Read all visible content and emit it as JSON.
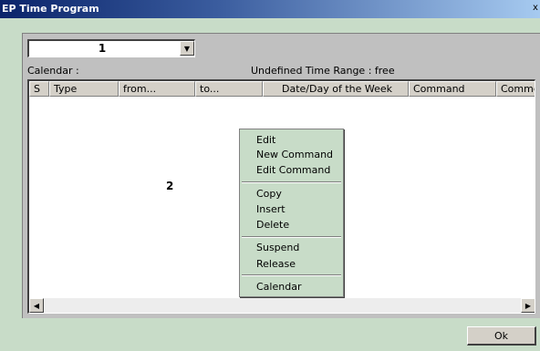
{
  "window": {
    "title": "EP Time Program",
    "close_glyph": "x"
  },
  "combo": {
    "value": "1",
    "arrow": "▼"
  },
  "calendar_label": "Calendar :",
  "range_label": "Undefined Time Range : free",
  "columns": [
    "S",
    "Type",
    "from...",
    "to...",
    "Date/Day of the Week",
    "Command",
    "Comme"
  ],
  "grid_label": "2",
  "scroll": {
    "left": "◀",
    "right": "▶"
  },
  "context_menu": {
    "edit": "Edit",
    "new_command": "New Command",
    "edit_command": "Edit Command",
    "copy": "Copy",
    "insert": "Insert",
    "delete": "Delete",
    "suspend": "Suspend",
    "release": "Release",
    "calendar": "Calendar"
  },
  "ok_label": "Ok"
}
